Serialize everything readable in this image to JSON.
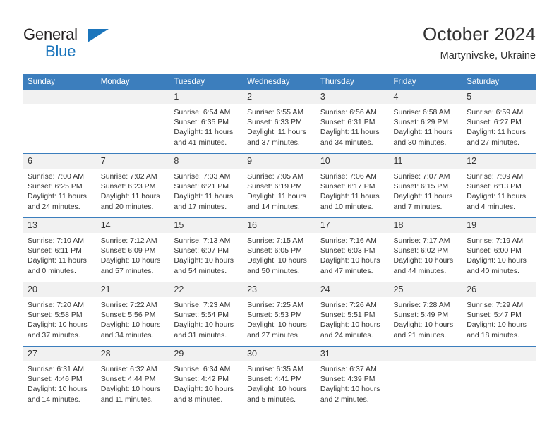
{
  "brand": {
    "name_part1": "General",
    "name_part2": "Blue",
    "triangle_color": "#1b75bc"
  },
  "header": {
    "title": "October 2024",
    "subtitle": "Martynivske, Ukraine"
  },
  "theme": {
    "header_blue": "#3c7ebd",
    "daynum_band": "#f1f1f1",
    "text": "#333333"
  },
  "calendar": {
    "weekday_headers": [
      "Sunday",
      "Monday",
      "Tuesday",
      "Wednesday",
      "Thursday",
      "Friday",
      "Saturday"
    ],
    "weeks": [
      [
        {
          "day": "",
          "lines": []
        },
        {
          "day": "",
          "lines": []
        },
        {
          "day": "1",
          "lines": [
            "Sunrise: 6:54 AM",
            "Sunset: 6:35 PM",
            "Daylight: 11 hours",
            "and 41 minutes."
          ]
        },
        {
          "day": "2",
          "lines": [
            "Sunrise: 6:55 AM",
            "Sunset: 6:33 PM",
            "Daylight: 11 hours",
            "and 37 minutes."
          ]
        },
        {
          "day": "3",
          "lines": [
            "Sunrise: 6:56 AM",
            "Sunset: 6:31 PM",
            "Daylight: 11 hours",
            "and 34 minutes."
          ]
        },
        {
          "day": "4",
          "lines": [
            "Sunrise: 6:58 AM",
            "Sunset: 6:29 PM",
            "Daylight: 11 hours",
            "and 30 minutes."
          ]
        },
        {
          "day": "5",
          "lines": [
            "Sunrise: 6:59 AM",
            "Sunset: 6:27 PM",
            "Daylight: 11 hours",
            "and 27 minutes."
          ]
        }
      ],
      [
        {
          "day": "6",
          "lines": [
            "Sunrise: 7:00 AM",
            "Sunset: 6:25 PM",
            "Daylight: 11 hours",
            "and 24 minutes."
          ]
        },
        {
          "day": "7",
          "lines": [
            "Sunrise: 7:02 AM",
            "Sunset: 6:23 PM",
            "Daylight: 11 hours",
            "and 20 minutes."
          ]
        },
        {
          "day": "8",
          "lines": [
            "Sunrise: 7:03 AM",
            "Sunset: 6:21 PM",
            "Daylight: 11 hours",
            "and 17 minutes."
          ]
        },
        {
          "day": "9",
          "lines": [
            "Sunrise: 7:05 AM",
            "Sunset: 6:19 PM",
            "Daylight: 11 hours",
            "and 14 minutes."
          ]
        },
        {
          "day": "10",
          "lines": [
            "Sunrise: 7:06 AM",
            "Sunset: 6:17 PM",
            "Daylight: 11 hours",
            "and 10 minutes."
          ]
        },
        {
          "day": "11",
          "lines": [
            "Sunrise: 7:07 AM",
            "Sunset: 6:15 PM",
            "Daylight: 11 hours",
            "and 7 minutes."
          ]
        },
        {
          "day": "12",
          "lines": [
            "Sunrise: 7:09 AM",
            "Sunset: 6:13 PM",
            "Daylight: 11 hours",
            "and 4 minutes."
          ]
        }
      ],
      [
        {
          "day": "13",
          "lines": [
            "Sunrise: 7:10 AM",
            "Sunset: 6:11 PM",
            "Daylight: 11 hours",
            "and 0 minutes."
          ]
        },
        {
          "day": "14",
          "lines": [
            "Sunrise: 7:12 AM",
            "Sunset: 6:09 PM",
            "Daylight: 10 hours",
            "and 57 minutes."
          ]
        },
        {
          "day": "15",
          "lines": [
            "Sunrise: 7:13 AM",
            "Sunset: 6:07 PM",
            "Daylight: 10 hours",
            "and 54 minutes."
          ]
        },
        {
          "day": "16",
          "lines": [
            "Sunrise: 7:15 AM",
            "Sunset: 6:05 PM",
            "Daylight: 10 hours",
            "and 50 minutes."
          ]
        },
        {
          "day": "17",
          "lines": [
            "Sunrise: 7:16 AM",
            "Sunset: 6:03 PM",
            "Daylight: 10 hours",
            "and 47 minutes."
          ]
        },
        {
          "day": "18",
          "lines": [
            "Sunrise: 7:17 AM",
            "Sunset: 6:02 PM",
            "Daylight: 10 hours",
            "and 44 minutes."
          ]
        },
        {
          "day": "19",
          "lines": [
            "Sunrise: 7:19 AM",
            "Sunset: 6:00 PM",
            "Daylight: 10 hours",
            "and 40 minutes."
          ]
        }
      ],
      [
        {
          "day": "20",
          "lines": [
            "Sunrise: 7:20 AM",
            "Sunset: 5:58 PM",
            "Daylight: 10 hours",
            "and 37 minutes."
          ]
        },
        {
          "day": "21",
          "lines": [
            "Sunrise: 7:22 AM",
            "Sunset: 5:56 PM",
            "Daylight: 10 hours",
            "and 34 minutes."
          ]
        },
        {
          "day": "22",
          "lines": [
            "Sunrise: 7:23 AM",
            "Sunset: 5:54 PM",
            "Daylight: 10 hours",
            "and 31 minutes."
          ]
        },
        {
          "day": "23",
          "lines": [
            "Sunrise: 7:25 AM",
            "Sunset: 5:53 PM",
            "Daylight: 10 hours",
            "and 27 minutes."
          ]
        },
        {
          "day": "24",
          "lines": [
            "Sunrise: 7:26 AM",
            "Sunset: 5:51 PM",
            "Daylight: 10 hours",
            "and 24 minutes."
          ]
        },
        {
          "day": "25",
          "lines": [
            "Sunrise: 7:28 AM",
            "Sunset: 5:49 PM",
            "Daylight: 10 hours",
            "and 21 minutes."
          ]
        },
        {
          "day": "26",
          "lines": [
            "Sunrise: 7:29 AM",
            "Sunset: 5:47 PM",
            "Daylight: 10 hours",
            "and 18 minutes."
          ]
        }
      ],
      [
        {
          "day": "27",
          "lines": [
            "Sunrise: 6:31 AM",
            "Sunset: 4:46 PM",
            "Daylight: 10 hours",
            "and 14 minutes."
          ]
        },
        {
          "day": "28",
          "lines": [
            "Sunrise: 6:32 AM",
            "Sunset: 4:44 PM",
            "Daylight: 10 hours",
            "and 11 minutes."
          ]
        },
        {
          "day": "29",
          "lines": [
            "Sunrise: 6:34 AM",
            "Sunset: 4:42 PM",
            "Daylight: 10 hours",
            "and 8 minutes."
          ]
        },
        {
          "day": "30",
          "lines": [
            "Sunrise: 6:35 AM",
            "Sunset: 4:41 PM",
            "Daylight: 10 hours",
            "and 5 minutes."
          ]
        },
        {
          "day": "31",
          "lines": [
            "Sunrise: 6:37 AM",
            "Sunset: 4:39 PM",
            "Daylight: 10 hours",
            "and 2 minutes."
          ]
        },
        {
          "day": "",
          "lines": []
        },
        {
          "day": "",
          "lines": []
        }
      ]
    ]
  }
}
